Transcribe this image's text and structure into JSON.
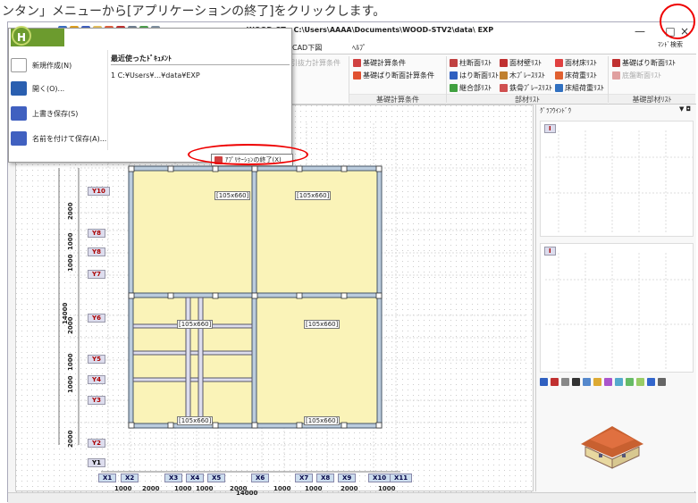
{
  "caption": "ンタン」メニューから[アプリケーションの終了]をクリックします。",
  "window": {
    "title": "WOOD-ST - C:\\Users\\AAAA\\Documents\\WOOD-STV2\\data\\ EXP",
    "close_glyph": "×",
    "max_glyph": "□",
    "min_glyph": "—"
  },
  "menubar": [
    "CAD下図",
    "ﾍﾙﾌﾟ"
  ],
  "ribbon": {
    "col1": [
      "基礎計算条件",
      "基礎ばり断面計算条件"
    ],
    "faded": "引抜力計算条件",
    "col2": [
      "柱断面ﾘｽﾄ",
      "はり断面ﾘｽﾄ",
      "継合部ﾘｽﾄ"
    ],
    "col3": [
      "面材壁ﾘｽﾄ",
      "木ﾌﾞﾚｰｽﾘｽﾄ",
      "鉄骨ﾌﾞﾚｰｽﾘｽﾄ"
    ],
    "col4": [
      "面材床ﾘｽﾄ",
      "床荷重ﾘｽﾄ",
      "床組荷重ﾘｽﾄ"
    ],
    "col5": [
      "基礎ばり断面ﾘｽﾄ",
      "底盤断面ﾘｽﾄ"
    ],
    "groups": [
      "基礎計算条件",
      "部材ﾘｽﾄ",
      "基礎部材ﾘｽﾄ"
    ]
  },
  "search_cmd": "ﾏﾝﾄﾞ検索",
  "app_menu": {
    "items": [
      "新規作成(N)",
      "開く(O)...",
      "上書き保存(S)",
      "名前を付けて保存(A)..."
    ],
    "recent_title": "最近使ったﾄﾞｷｭﾒﾝﾄ",
    "recent_items": [
      "1 C:¥Users¥...¥data¥EXP"
    ],
    "exit_label": "ｱﾌﾟﾘｹｰｼｮﾝの終了(X)"
  },
  "logo": "H",
  "right_pane": {
    "title": "ｸﾞﾗﾌｳｲﾝﾄﾞｳ",
    "pin": "▼ ◘",
    "graph1_tag": "I",
    "graph2_tag": "I"
  },
  "plan": {
    "y_tags": [
      "Y10",
      "Y8",
      "Y8",
      "Y7",
      "Y6",
      "Y5",
      "Y4",
      "Y3",
      "Y2",
      "Y1"
    ],
    "x_tags": [
      "X1",
      "X2",
      "X3",
      "X4",
      "X5",
      "X6",
      "X7",
      "X8",
      "X9",
      "X10",
      "X11"
    ],
    "panel_label": "[105x660]",
    "x_dims": [
      "1000",
      "2000",
      "1000",
      "1000",
      "2000",
      "1000",
      "1000",
      "2000",
      "1000"
    ],
    "x_total": "14000",
    "y_dims": [
      "2000",
      "1000",
      "1000",
      "2000",
      "1000",
      "1000",
      "2000"
    ],
    "y_total": "14000"
  }
}
